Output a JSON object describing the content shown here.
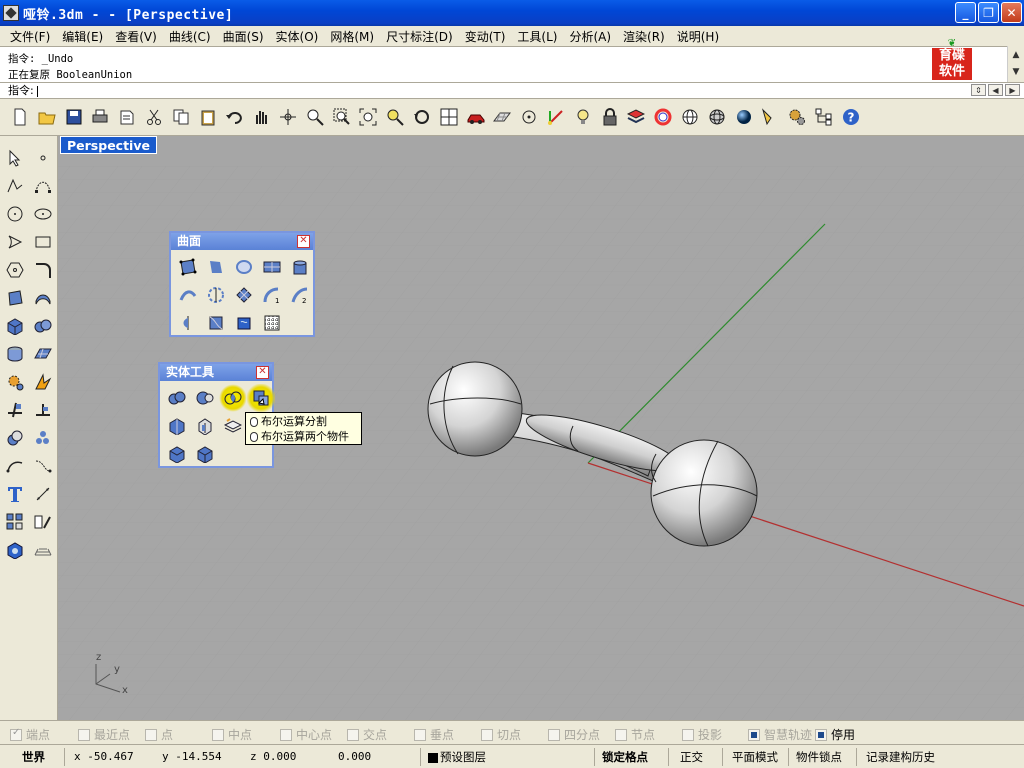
{
  "window": {
    "title": "哑铃.3dm -  - [Perspective]"
  },
  "menu": [
    "文件(F)",
    "编辑(E)",
    "查看(V)",
    "曲线(C)",
    "曲面(S)",
    "实体(O)",
    "网格(M)",
    "尺寸标注(D)",
    "变动(T)",
    "工具(L)",
    "分析(A)",
    "渲染(R)",
    "说明(H)"
  ],
  "command": {
    "history": [
      "指令: _Undo",
      "正在复原 BooleanUnion"
    ],
    "prompt": "指令: "
  },
  "logo": {
    "line1": "育碟",
    "line2": "软件"
  },
  "viewport": {
    "label": "Perspective",
    "axis_z": "z",
    "axis_y": "y",
    "axis_x": "x"
  },
  "surface_panel": {
    "title": "曲面"
  },
  "solid_panel": {
    "title": "实体工具"
  },
  "tooltip": {
    "line1": "布尔运算分割",
    "line2": "布尔运算两个物件"
  },
  "osnap": [
    {
      "label": "端点",
      "state": "gray-checked"
    },
    {
      "label": "最近点",
      "state": "off"
    },
    {
      "label": "点",
      "state": "off"
    },
    {
      "label": "中点",
      "state": "off"
    },
    {
      "label": "中心点",
      "state": "off"
    },
    {
      "label": "交点",
      "state": "off"
    },
    {
      "label": "垂点",
      "state": "off"
    },
    {
      "label": "切点",
      "state": "off"
    },
    {
      "label": "四分点",
      "state": "off"
    },
    {
      "label": "节点",
      "state": "off"
    },
    {
      "label": "投影",
      "state": "off"
    },
    {
      "label": "智慧轨迹",
      "state": "checked-dim"
    },
    {
      "label": "停用",
      "state": "checked"
    }
  ],
  "status": {
    "cplane": "世界",
    "x": "x -50.467",
    "y": "y -14.554",
    "z": "z 0.000",
    "extra": "0.000",
    "layer": "预设图层",
    "grid_snap": "锁定格点",
    "ortho": "正交",
    "planar": "平面模式",
    "osnap": "物件锁点",
    "history": "记录建构历史"
  },
  "colors": {
    "title_bar": "#0a5ce8",
    "viewport_bg": "#a8a8a8",
    "x_axis": "#b33030",
    "y_axis": "#2e8b2e",
    "label_bg": "#1a5bcc"
  }
}
